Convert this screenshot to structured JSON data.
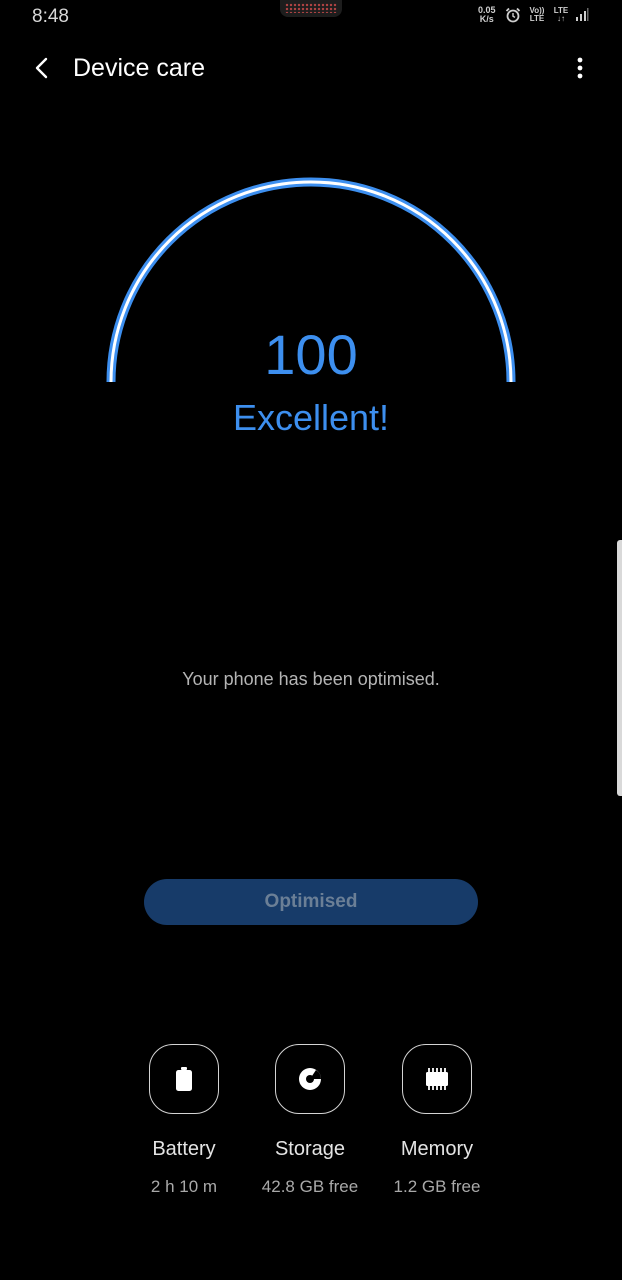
{
  "status_bar": {
    "time": "8:48",
    "net_speed_value": "0.05",
    "net_speed_unit": "K/s",
    "volte": "Vo)) LTE",
    "lte": "LTE",
    "icons": [
      "alarm-icon",
      "volte-icon",
      "lte-icon",
      "signal-icon"
    ]
  },
  "app_bar": {
    "title": "Device care",
    "back_icon": "back-arrow-icon",
    "more_icon": "more-options-icon"
  },
  "score": {
    "value": "100",
    "label": "Excellent!",
    "gauge_level": 1.0,
    "color": "#3d8fef"
  },
  "message": "Your phone has been optimised.",
  "action_button": {
    "label": "Optimised",
    "enabled": false,
    "color": "#173b69"
  },
  "tiles": [
    {
      "name": "Battery",
      "value": "2 h 10 m",
      "icon": "battery-icon"
    },
    {
      "name": "Storage",
      "value": "42.8 GB free",
      "icon": "storage-icon"
    },
    {
      "name": "Memory",
      "value": "1.2 GB free",
      "icon": "memory-icon"
    }
  ]
}
